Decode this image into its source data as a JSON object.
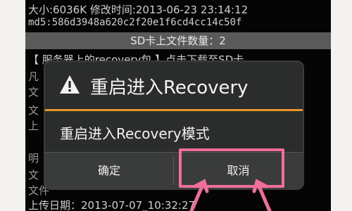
{
  "background_lines": {
    "size_line": "大小:6036K 修改时间:2013-06-23 23:14:12",
    "md5_line": "md5:586d3948a620c2f20e1f6cd4cc14c50f",
    "sd_count": "SD卡上文件数量：2",
    "server_line": "【 服务器上的recovery包 】点击下载至SD卡",
    "frag_1": "凡",
    "frag_2": "文",
    "frag_3": "文",
    "frag_4": "上",
    "frag_5": "明",
    "frag_6": "文",
    "frag_7": "文件",
    "upload_date": "上传日期：2013-07-07_10:32:27"
  },
  "dialog": {
    "title": "重启进入Recovery",
    "message": "重启进入Recovery模式",
    "ok_label": "确定",
    "cancel_label": "取消"
  },
  "colors": {
    "accent_orange": "#e8962a",
    "highlight_pink": "#ef6e9c",
    "dialog_bg": "#2b2c2c"
  },
  "icons": {
    "warning": "warning-triangle-icon"
  }
}
